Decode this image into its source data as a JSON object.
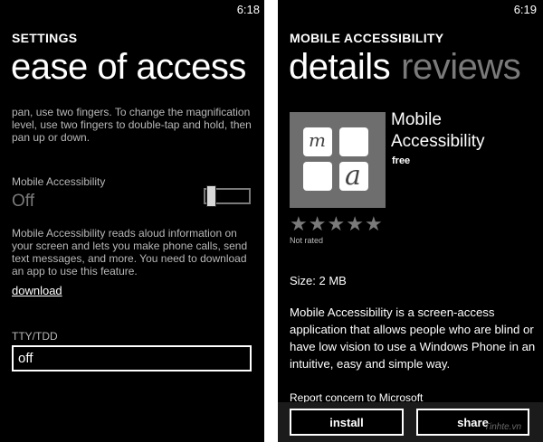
{
  "left": {
    "time": "6:18",
    "app_title": "SETTINGS",
    "page_title": "ease of access",
    "magnifier_text": "pan, use two fingers.  To change the magnification level, use two fingers to double-tap and hold, then pan up or down.",
    "mobile_accessibility": {
      "label": "Mobile Accessibility",
      "value": "Off",
      "toggle_on": false,
      "description": "Mobile Accessibility reads aloud information on your screen and lets you make phone calls, send text messages, and more. You need to download an app to use this feature.",
      "link": "download"
    },
    "tty": {
      "label": "TTY/TDD",
      "value": "off"
    }
  },
  "right": {
    "time": "6:19",
    "app_title": "MOBILE ACCESSIBILITY",
    "pivot_active": "details",
    "pivot_inactive": "reviews",
    "icon_letters": [
      "m",
      "a"
    ],
    "app_name": "Mobile Accessibility",
    "price": "free",
    "rating_text": "Not rated",
    "rating_value": 0,
    "rating_max": 5,
    "size": "Size: 2 MB",
    "description": "Mobile Accessibility is a screen-access application that allows people who are blind or have low vision to use a Windows Phone in an intuitive, easy and simple way.",
    "report": "Report concern to Microsoft",
    "install_label": "install",
    "share_label": "share"
  },
  "watermark": "Tinhte.vn",
  "colors": {
    "background": "#000000",
    "text": "#ffffff",
    "subtle_text": "#b8b8b8",
    "inactive": "#7a7a7a",
    "icon_bg": "#6e6e6e"
  }
}
